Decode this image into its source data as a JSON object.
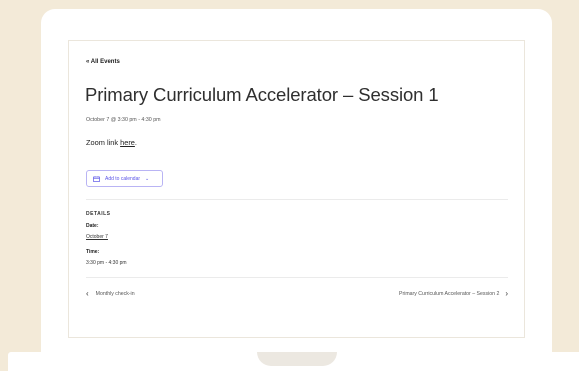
{
  "nav": {
    "all_events_label": "« All Events"
  },
  "event": {
    "title": "Primary Curriculum Accelerator – Session 1",
    "datetime": "October 7 @ 3:30 pm - 4:30 pm",
    "zoom_prefix": "Zoom link ",
    "zoom_link_label": "here",
    "zoom_suffix": "."
  },
  "calendar": {
    "button_label": "Add to calendar",
    "icon": "calendar-icon",
    "chevron_icon": "chevron-down-icon"
  },
  "details": {
    "heading": "DETAILS",
    "date_label": "Date:",
    "date_value": "October 7",
    "time_label": "Time:",
    "time_value": "3:30 pm - 4:30 pm"
  },
  "pagination": {
    "prev_label": "Monthly check-in",
    "next_label": "Primary Curriculum Accelerator – Session 2",
    "prev_icon": "chevron-left-icon",
    "next_icon": "chevron-right-icon"
  },
  "colors": {
    "background": "#f3ead8",
    "accent": "#5a54e8"
  }
}
